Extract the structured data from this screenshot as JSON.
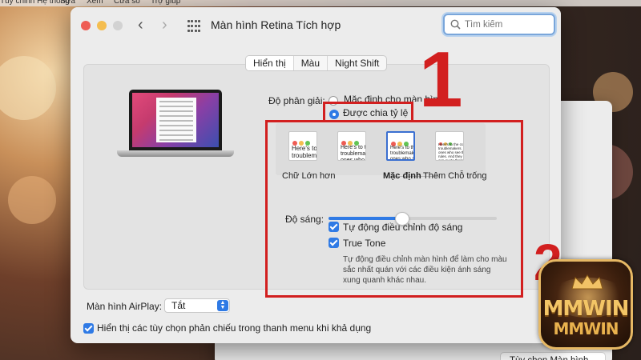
{
  "menubar": {
    "items": [
      "Tùy chỉnh Hệ thống",
      "Sửa",
      "Xem",
      "Cửa sổ",
      "Trợ giúp"
    ]
  },
  "window": {
    "title": "Màn hình Retina Tích hợp",
    "search_placeholder": "Tìm kiếm"
  },
  "tabs": [
    {
      "label": "Hiển thị",
      "active": true
    },
    {
      "label": "Màu",
      "active": false
    },
    {
      "label": "Night Shift",
      "active": false
    }
  ],
  "resolution": {
    "label": "Độ phân giải:",
    "option_default": "Mặc định cho màn hình",
    "option_scaled": "Được chia tỷ lệ",
    "selected": "option_scaled"
  },
  "scale": {
    "thumbnails": [
      {
        "text": "Here's to\ntroublem"
      },
      {
        "text": "Here's to t\ntroublema\nones who"
      },
      {
        "text": "Here's to the\ntroublemakers\nones who see t\nrules. And they"
      },
      {
        "text": "Here's to the crazy\ntroublemakers. The\nones who see things\nrules. And they hav\ncan quote them, dis\nthem. About the only"
      }
    ],
    "label_larger": "Chữ Lớn hơn",
    "label_default": "Mặc định",
    "label_more_space": "Thêm Chỗ trống",
    "selected_index": 2
  },
  "brightness": {
    "label": "Độ sáng:",
    "level": 0.44,
    "auto_label": "Tự động điều chỉnh độ sáng",
    "auto_checked": true,
    "truetone_label": "True Tone",
    "truetone_checked": true,
    "truetone_desc": [
      "Tự động điều chỉnh màn hình để làm cho màu",
      "sắc nhất quán với các điều kiện ánh sáng",
      "xung quanh khác nhau."
    ]
  },
  "airplay": {
    "label": "Màn hình AirPlay:",
    "value": "Tắt"
  },
  "mirroring": {
    "label": "Hiển thị các tùy chọn phản chiếu trong thanh menu khi khả dụng",
    "checked": true
  },
  "back_window": {
    "button_label": "Tùy chọn Màn hình..."
  },
  "annotations": {
    "step1": "1",
    "step2": "2"
  },
  "logo": {
    "line1": "MMWIN",
    "line2": "MMWIN"
  },
  "colors": {
    "accent": "#2f7ae5",
    "highlight": "#d21f1f"
  }
}
